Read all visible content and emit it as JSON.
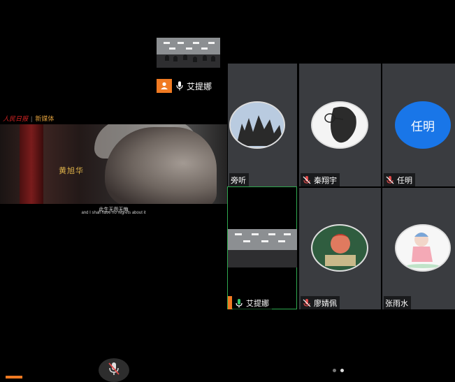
{
  "self_view": {
    "name": "艾提娜",
    "avatar_color": "#f07a22"
  },
  "video": {
    "logo_brand": "人民日报",
    "logo_label": "新媒体",
    "person_name": "黄旭华",
    "subtitle_cn": "此生无怨无悔",
    "subtitle_en": "and I shall have no regrets about it"
  },
  "participants": [
    {
      "name": "旁听",
      "mic": "none",
      "avatar": "tree-photo"
    },
    {
      "name": "秦翔宇",
      "mic": "muted",
      "avatar": "sketch-photo"
    },
    {
      "name": "任明",
      "mic": "muted",
      "avatar_text": "任明",
      "avatar_color": "#1976e8"
    },
    {
      "name": "艾提娜",
      "mic": "on",
      "avatar": "classroom-video"
    },
    {
      "name": "廖婧佩",
      "mic": "muted",
      "avatar": "portrait-photo"
    },
    {
      "name": "张雨水",
      "mic": "none",
      "avatar": "cartoon-photo"
    }
  ],
  "pagination": {
    "pages": 2,
    "current": 2
  },
  "colors": {
    "tile_bg": "#3a3c40",
    "active_border": "#2fa84f",
    "muted_mic": "#e04b4b",
    "on_mic": "#39c36b"
  }
}
